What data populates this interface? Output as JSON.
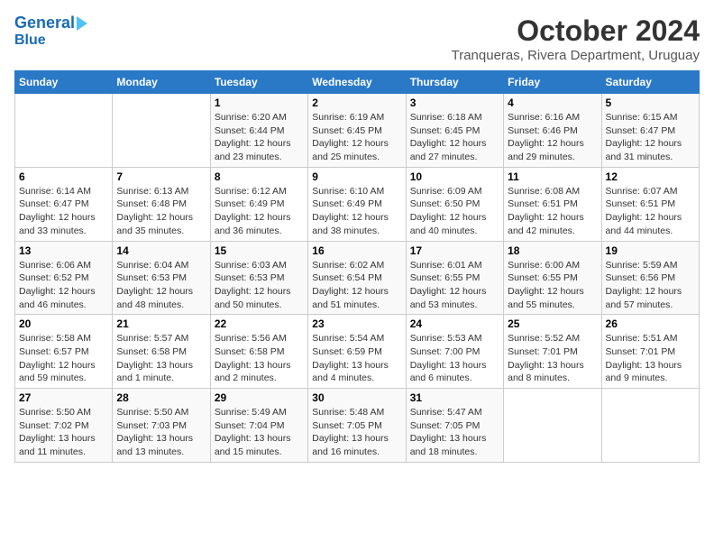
{
  "header": {
    "logo_line1": "General",
    "logo_line2": "Blue",
    "month": "October 2024",
    "location": "Tranqueras, Rivera Department, Uruguay"
  },
  "weekdays": [
    "Sunday",
    "Monday",
    "Tuesday",
    "Wednesday",
    "Thursday",
    "Friday",
    "Saturday"
  ],
  "weeks": [
    [
      {
        "day": "",
        "content": ""
      },
      {
        "day": "",
        "content": ""
      },
      {
        "day": "1",
        "content": "Sunrise: 6:20 AM\nSunset: 6:44 PM\nDaylight: 12 hours and 23 minutes."
      },
      {
        "day": "2",
        "content": "Sunrise: 6:19 AM\nSunset: 6:45 PM\nDaylight: 12 hours and 25 minutes."
      },
      {
        "day": "3",
        "content": "Sunrise: 6:18 AM\nSunset: 6:45 PM\nDaylight: 12 hours and 27 minutes."
      },
      {
        "day": "4",
        "content": "Sunrise: 6:16 AM\nSunset: 6:46 PM\nDaylight: 12 hours and 29 minutes."
      },
      {
        "day": "5",
        "content": "Sunrise: 6:15 AM\nSunset: 6:47 PM\nDaylight: 12 hours and 31 minutes."
      }
    ],
    [
      {
        "day": "6",
        "content": "Sunrise: 6:14 AM\nSunset: 6:47 PM\nDaylight: 12 hours and 33 minutes."
      },
      {
        "day": "7",
        "content": "Sunrise: 6:13 AM\nSunset: 6:48 PM\nDaylight: 12 hours and 35 minutes."
      },
      {
        "day": "8",
        "content": "Sunrise: 6:12 AM\nSunset: 6:49 PM\nDaylight: 12 hours and 36 minutes."
      },
      {
        "day": "9",
        "content": "Sunrise: 6:10 AM\nSunset: 6:49 PM\nDaylight: 12 hours and 38 minutes."
      },
      {
        "day": "10",
        "content": "Sunrise: 6:09 AM\nSunset: 6:50 PM\nDaylight: 12 hours and 40 minutes."
      },
      {
        "day": "11",
        "content": "Sunrise: 6:08 AM\nSunset: 6:51 PM\nDaylight: 12 hours and 42 minutes."
      },
      {
        "day": "12",
        "content": "Sunrise: 6:07 AM\nSunset: 6:51 PM\nDaylight: 12 hours and 44 minutes."
      }
    ],
    [
      {
        "day": "13",
        "content": "Sunrise: 6:06 AM\nSunset: 6:52 PM\nDaylight: 12 hours and 46 minutes."
      },
      {
        "day": "14",
        "content": "Sunrise: 6:04 AM\nSunset: 6:53 PM\nDaylight: 12 hours and 48 minutes."
      },
      {
        "day": "15",
        "content": "Sunrise: 6:03 AM\nSunset: 6:53 PM\nDaylight: 12 hours and 50 minutes."
      },
      {
        "day": "16",
        "content": "Sunrise: 6:02 AM\nSunset: 6:54 PM\nDaylight: 12 hours and 51 minutes."
      },
      {
        "day": "17",
        "content": "Sunrise: 6:01 AM\nSunset: 6:55 PM\nDaylight: 12 hours and 53 minutes."
      },
      {
        "day": "18",
        "content": "Sunrise: 6:00 AM\nSunset: 6:55 PM\nDaylight: 12 hours and 55 minutes."
      },
      {
        "day": "19",
        "content": "Sunrise: 5:59 AM\nSunset: 6:56 PM\nDaylight: 12 hours and 57 minutes."
      }
    ],
    [
      {
        "day": "20",
        "content": "Sunrise: 5:58 AM\nSunset: 6:57 PM\nDaylight: 12 hours and 59 minutes."
      },
      {
        "day": "21",
        "content": "Sunrise: 5:57 AM\nSunset: 6:58 PM\nDaylight: 13 hours and 1 minute."
      },
      {
        "day": "22",
        "content": "Sunrise: 5:56 AM\nSunset: 6:58 PM\nDaylight: 13 hours and 2 minutes."
      },
      {
        "day": "23",
        "content": "Sunrise: 5:54 AM\nSunset: 6:59 PM\nDaylight: 13 hours and 4 minutes."
      },
      {
        "day": "24",
        "content": "Sunrise: 5:53 AM\nSunset: 7:00 PM\nDaylight: 13 hours and 6 minutes."
      },
      {
        "day": "25",
        "content": "Sunrise: 5:52 AM\nSunset: 7:01 PM\nDaylight: 13 hours and 8 minutes."
      },
      {
        "day": "26",
        "content": "Sunrise: 5:51 AM\nSunset: 7:01 PM\nDaylight: 13 hours and 9 minutes."
      }
    ],
    [
      {
        "day": "27",
        "content": "Sunrise: 5:50 AM\nSunset: 7:02 PM\nDaylight: 13 hours and 11 minutes."
      },
      {
        "day": "28",
        "content": "Sunrise: 5:50 AM\nSunset: 7:03 PM\nDaylight: 13 hours and 13 minutes."
      },
      {
        "day": "29",
        "content": "Sunrise: 5:49 AM\nSunset: 7:04 PM\nDaylight: 13 hours and 15 minutes."
      },
      {
        "day": "30",
        "content": "Sunrise: 5:48 AM\nSunset: 7:05 PM\nDaylight: 13 hours and 16 minutes."
      },
      {
        "day": "31",
        "content": "Sunrise: 5:47 AM\nSunset: 7:05 PM\nDaylight: 13 hours and 18 minutes."
      },
      {
        "day": "",
        "content": ""
      },
      {
        "day": "",
        "content": ""
      }
    ]
  ]
}
